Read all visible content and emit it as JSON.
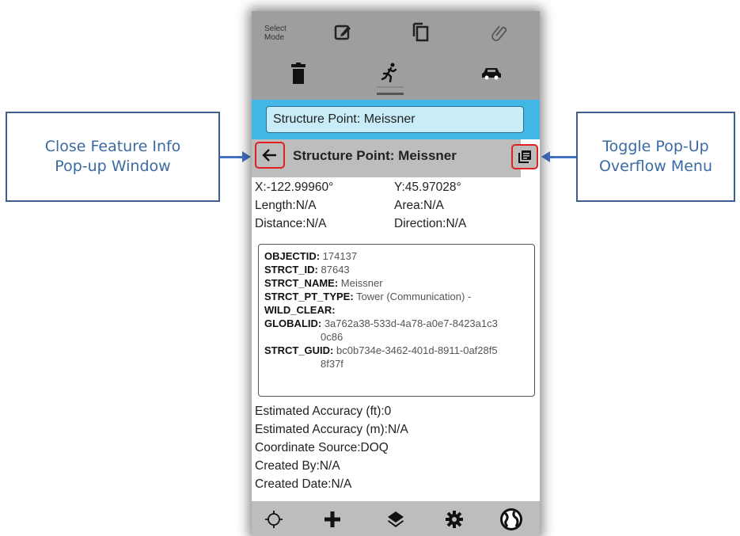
{
  "callouts": {
    "left_line1": "Close Feature Info",
    "left_line2": "Pop-up Window",
    "right_line1": "Toggle Pop-Up",
    "right_line2": "Overflow Menu"
  },
  "toolbar": {
    "select_mode_line1": "Select",
    "select_mode_line2": "Mode",
    "icons": [
      "edit-icon",
      "copy-icon",
      "attach-icon",
      "delete-icon",
      "walk-icon",
      "car-icon"
    ]
  },
  "search": {
    "value": "Structure Point: Meissner"
  },
  "popup": {
    "title": "Structure Point: Meissner",
    "x": "X:-122.99960°",
    "y": "Y:45.97028°",
    "length": "Length:N/A",
    "area": "Area:N/A",
    "distance": "Distance:N/A",
    "direction": "Direction:N/A",
    "attributes": [
      {
        "key": "OBJECTID:",
        "value": " 174137"
      },
      {
        "key": "STRCT_ID:",
        "value": " 87643"
      },
      {
        "key": "STRCT_NAME:",
        "value": " Meissner"
      },
      {
        "key": "STRCT_PT_TYPE:",
        "value": " Tower (Communication) -"
      },
      {
        "key": "WILD_CLEAR:",
        "value": ""
      },
      {
        "key": "GLOBALID:",
        "value": " 3a762a38-533d-4a78-a0e7-8423a1c3",
        "cont": "0c86"
      },
      {
        "key": "STRCT_GUID:",
        "value": " bc0b734e-3462-401d-8911-0af28f5",
        "cont": "8f37f"
      }
    ],
    "est_acc_ft": "Estimated Accuracy (ft):0",
    "est_acc_m": "Estimated Accuracy (m):N/A",
    "coord_source": "Coordinate Source:DOQ",
    "created_by": "Created By:N/A",
    "created_date": "Created Date:N/A"
  },
  "bottom_bar": {
    "icons": [
      "locate-icon",
      "add-icon",
      "layers-icon",
      "settings-icon",
      "globe-icon"
    ]
  },
  "colors": {
    "accent_blue": "#42b7e6",
    "callout_text": "#3b6aa3",
    "highlight_red": "#e02020",
    "toolbar_gray": "#9e9e9e"
  }
}
